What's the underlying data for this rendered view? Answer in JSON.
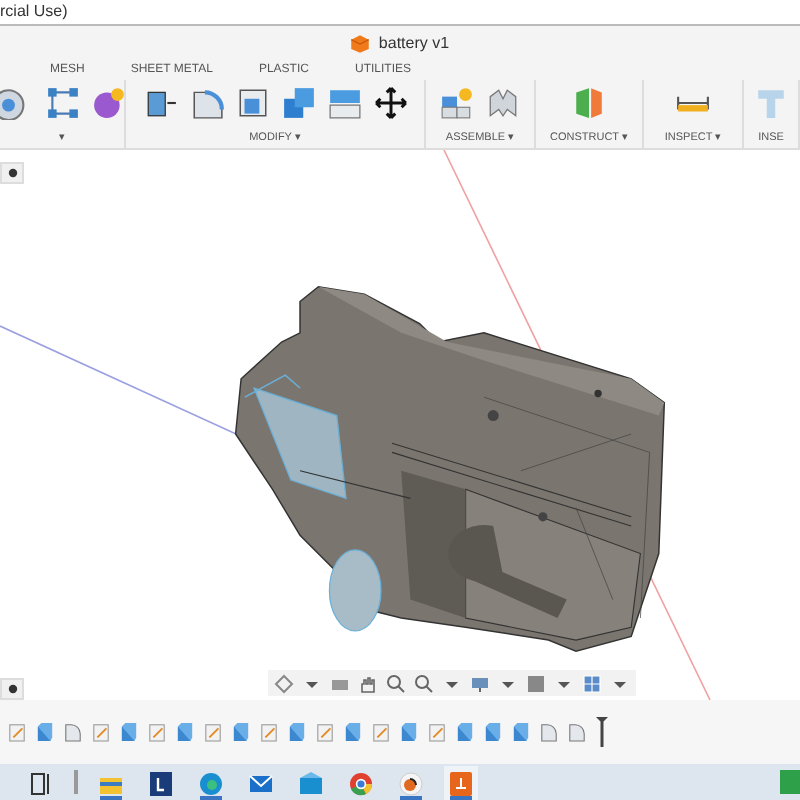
{
  "window": {
    "title": "rcial Use)"
  },
  "document_tab": {
    "title": "battery v1"
  },
  "toolbar": {
    "tabs": [
      "MESH",
      "SHEET METAL",
      "PLASTIC",
      "UTILITIES"
    ],
    "groups": [
      {
        "label": "▾",
        "icons": [
          {
            "kind": "form"
          },
          {
            "kind": "mesh"
          },
          {
            "kind": "sphere"
          }
        ]
      },
      {
        "label": "MODIFY ▾",
        "icons": [
          {
            "kind": "press-pull"
          },
          {
            "kind": "fillet"
          },
          {
            "kind": "shell"
          },
          {
            "kind": "combine"
          },
          {
            "kind": "split"
          },
          {
            "kind": "move"
          }
        ]
      },
      {
        "label": "ASSEMBLE ▾",
        "icons": [
          {
            "kind": "joint"
          },
          {
            "kind": "joint-origin"
          }
        ]
      },
      {
        "label": "CONSTRUCT ▾",
        "icons": [
          {
            "kind": "plane"
          }
        ]
      },
      {
        "label": "INSPECT ▾",
        "icons": [
          {
            "kind": "measure"
          }
        ]
      },
      {
        "label": "INSE",
        "icons": [
          {
            "kind": "insert"
          }
        ]
      }
    ]
  },
  "timeline": {
    "items": [
      {
        "kind": "sketch"
      },
      {
        "kind": "extrude"
      },
      {
        "kind": "fillet"
      },
      {
        "kind": "sketch"
      },
      {
        "kind": "extrude"
      },
      {
        "kind": "sketch"
      },
      {
        "kind": "extrude"
      },
      {
        "kind": "sketch"
      },
      {
        "kind": "extrude"
      },
      {
        "kind": "sketch"
      },
      {
        "kind": "extrude"
      },
      {
        "kind": "sketch"
      },
      {
        "kind": "extrude"
      },
      {
        "kind": "sketch"
      },
      {
        "kind": "extrude"
      },
      {
        "kind": "sketch"
      },
      {
        "kind": "extrude"
      },
      {
        "kind": "extrude"
      },
      {
        "kind": "extrude"
      },
      {
        "kind": "fillet"
      },
      {
        "kind": "fillet"
      }
    ]
  },
  "taskbar": {
    "apps": [
      {
        "kind": "task-view",
        "running": false,
        "selected": false
      },
      {
        "kind": "folder",
        "running": true,
        "selected": false
      },
      {
        "kind": "letter-app",
        "running": false,
        "selected": false
      },
      {
        "kind": "browser-edge",
        "running": true,
        "selected": false
      },
      {
        "kind": "mail",
        "running": false,
        "selected": false
      },
      {
        "kind": "mail-open",
        "running": false,
        "selected": false
      },
      {
        "kind": "browser-chrome",
        "running": false,
        "selected": false
      },
      {
        "kind": "round-app",
        "running": true,
        "selected": false
      },
      {
        "kind": "cad-app",
        "running": true,
        "selected": true
      }
    ]
  }
}
